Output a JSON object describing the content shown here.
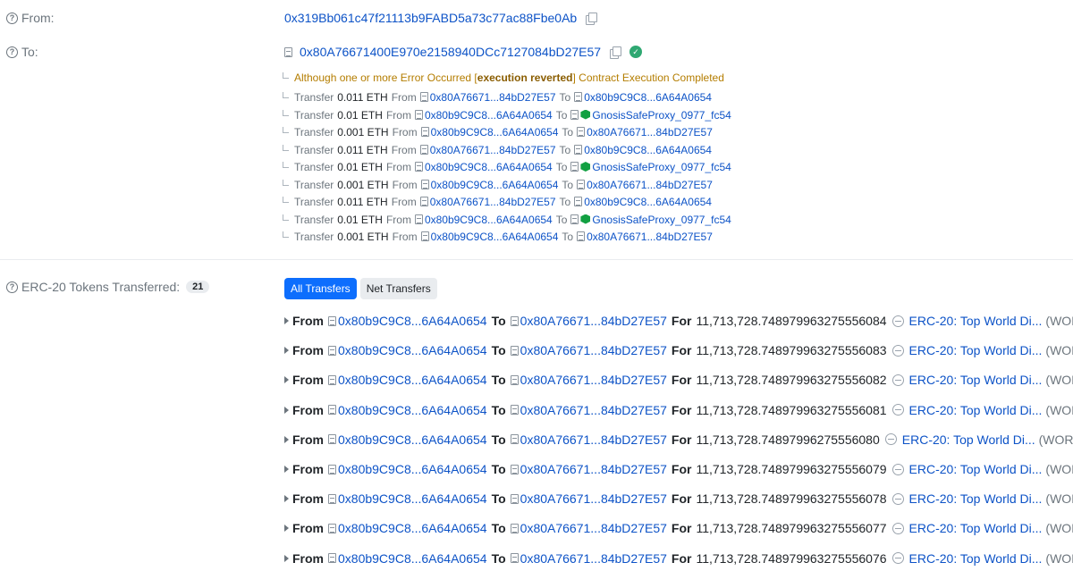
{
  "from": {
    "label": "From:",
    "address": "0x319Bb061c47f21113b9FABD5a73c77ac88Fbe0Ab"
  },
  "to": {
    "label": "To:",
    "address": "0x80A76671400E970e2158940DCc7127084bD27E57",
    "status_icon": "check-circle-icon"
  },
  "trace_warning": {
    "prefix": "Although one or more Error Occurred [",
    "error": "execution reverted",
    "suffix": "] Contract Execution Completed"
  },
  "internal_transfers": [
    {
      "word": "Transfer",
      "amount": "0.011 ETH",
      "from_word": "From",
      "from": "0x80A76671...84bD27E57",
      "to_word": "To",
      "to": "0x80b9C9C8...6A64A0654",
      "to_gnosis": false
    },
    {
      "word": "Transfer",
      "amount": "0.01 ETH",
      "from_word": "From",
      "from": "0x80b9C9C8...6A64A0654",
      "to_word": "To",
      "to": "GnosisSafeProxy_0977_fc54",
      "to_gnosis": true
    },
    {
      "word": "Transfer",
      "amount": "0.001 ETH",
      "from_word": "From",
      "from": "0x80b9C9C8...6A64A0654",
      "to_word": "To",
      "to": "0x80A76671...84bD27E57",
      "to_gnosis": false
    },
    {
      "word": "Transfer",
      "amount": "0.011 ETH",
      "from_word": "From",
      "from": "0x80A76671...84bD27E57",
      "to_word": "To",
      "to": "0x80b9C9C8...6A64A0654",
      "to_gnosis": false
    },
    {
      "word": "Transfer",
      "amount": "0.01 ETH",
      "from_word": "From",
      "from": "0x80b9C9C8...6A64A0654",
      "to_word": "To",
      "to": "GnosisSafeProxy_0977_fc54",
      "to_gnosis": true
    },
    {
      "word": "Transfer",
      "amount": "0.001 ETH",
      "from_word": "From",
      "from": "0x80b9C9C8...6A64A0654",
      "to_word": "To",
      "to": "0x80A76671...84bD27E57",
      "to_gnosis": false
    },
    {
      "word": "Transfer",
      "amount": "0.011 ETH",
      "from_word": "From",
      "from": "0x80A76671...84bD27E57",
      "to_word": "To",
      "to": "0x80b9C9C8...6A64A0654",
      "to_gnosis": false
    },
    {
      "word": "Transfer",
      "amount": "0.01 ETH",
      "from_word": "From",
      "from": "0x80b9C9C8...6A64A0654",
      "to_word": "To",
      "to": "GnosisSafeProxy_0977_fc54",
      "to_gnosis": true
    },
    {
      "word": "Transfer",
      "amount": "0.001 ETH",
      "from_word": "From",
      "from": "0x80b9C9C8...6A64A0654",
      "to_word": "To",
      "to": "0x80A76671...84bD27E57",
      "to_gnosis": false
    }
  ],
  "erc20": {
    "label": "ERC-20 Tokens Transferred:",
    "count": "21",
    "tabs": [
      {
        "label": "All Transfers",
        "active": true
      },
      {
        "label": "Net Transfers",
        "active": false
      }
    ],
    "rows": [
      {
        "from_word": "From",
        "from": "0x80b9C9C8...6A64A0654",
        "to_word": "To",
        "to": "0x80A76671...84bD27E57",
        "for_word": "For",
        "amount": "11,713,728.748979963275556084",
        "token": "ERC-20: Top World Di...",
        "symbol": "(WORLD)"
      },
      {
        "from_word": "From",
        "from": "0x80b9C9C8...6A64A0654",
        "to_word": "To",
        "to": "0x80A76671...84bD27E57",
        "for_word": "For",
        "amount": "11,713,728.748979963275556083",
        "token": "ERC-20: Top World Di...",
        "symbol": "(WORLD)"
      },
      {
        "from_word": "From",
        "from": "0x80b9C9C8...6A64A0654",
        "to_word": "To",
        "to": "0x80A76671...84bD27E57",
        "for_word": "For",
        "amount": "11,713,728.748979963275556082",
        "token": "ERC-20: Top World Di...",
        "symbol": "(WORLD)"
      },
      {
        "from_word": "From",
        "from": "0x80b9C9C8...6A64A0654",
        "to_word": "To",
        "to": "0x80A76671...84bD27E57",
        "for_word": "For",
        "amount": "11,713,728.748979963275556081",
        "token": "ERC-20: Top World Di...",
        "symbol": "(WORLD)"
      },
      {
        "from_word": "From",
        "from": "0x80b9C9C8...6A64A0654",
        "to_word": "To",
        "to": "0x80A76671...84bD27E57",
        "for_word": "For",
        "amount": "11,713,728.74897996275556080",
        "token": "ERC-20: Top World Di...",
        "symbol": "(WORLD)"
      },
      {
        "from_word": "From",
        "from": "0x80b9C9C8...6A64A0654",
        "to_word": "To",
        "to": "0x80A76671...84bD27E57",
        "for_word": "For",
        "amount": "11,713,728.748979963275556079",
        "token": "ERC-20: Top World Di...",
        "symbol": "(WORLD)"
      },
      {
        "from_word": "From",
        "from": "0x80b9C9C8...6A64A0654",
        "to_word": "To",
        "to": "0x80A76671...84bD27E57",
        "for_word": "For",
        "amount": "11,713,728.748979963275556078",
        "token": "ERC-20: Top World Di...",
        "symbol": "(WORLD)"
      },
      {
        "from_word": "From",
        "from": "0x80b9C9C8...6A64A0654",
        "to_word": "To",
        "to": "0x80A76671...84bD27E57",
        "for_word": "For",
        "amount": "11,713,728.748979963275556077",
        "token": "ERC-20: Top World Di...",
        "symbol": "(WORLD)"
      },
      {
        "from_word": "From",
        "from": "0x80b9C9C8...6A64A0654",
        "to_word": "To",
        "to": "0x80A76671...84bD27E57",
        "for_word": "For",
        "amount": "11,713,728.748979963275556076",
        "token": "ERC-20: Top World Di...",
        "symbol": "(WORLD)"
      }
    ]
  }
}
